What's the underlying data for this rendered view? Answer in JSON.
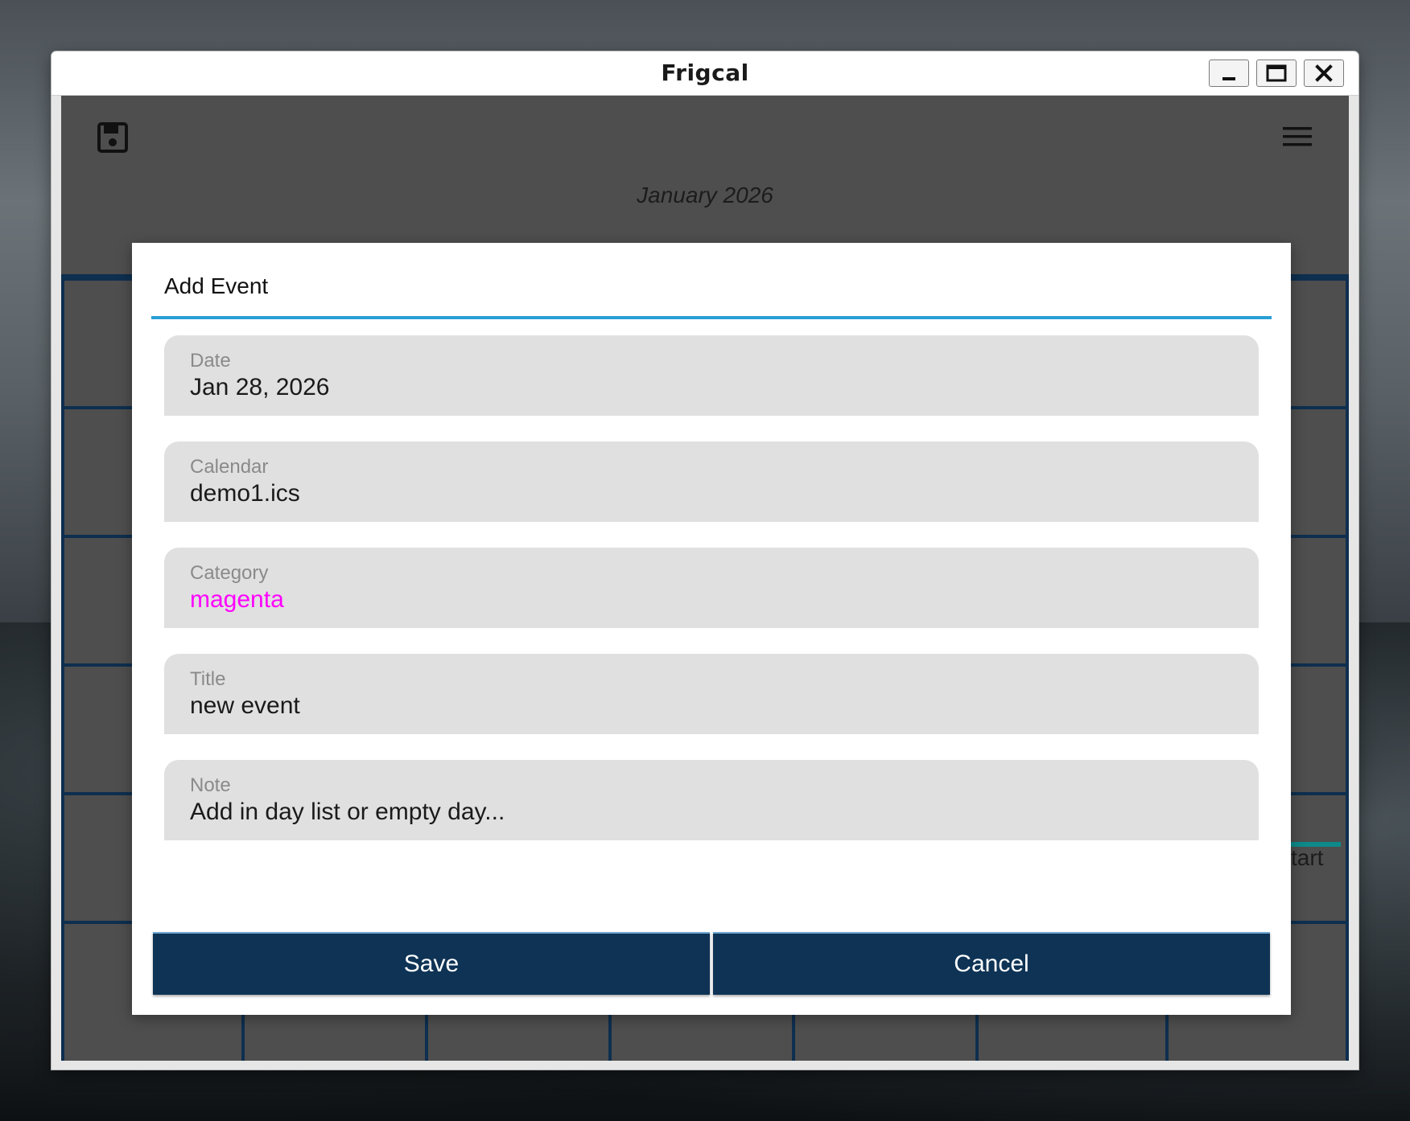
{
  "window": {
    "title": "Frigcal",
    "controls": {
      "minimize_icon": "minimize-icon",
      "maximize_icon": "maximize-icon",
      "close_icon": "close-icon"
    }
  },
  "toolbar": {
    "save_icon": "save-disk-icon",
    "menu_icon": "hamburger-menu-icon"
  },
  "calendar": {
    "month_label": "January 2026",
    "visible_event_text": "start"
  },
  "dialog": {
    "title": "Add Event",
    "fields": [
      {
        "label": "Date",
        "value": "Jan 28, 2026"
      },
      {
        "label": "Calendar",
        "value": "demo1.ics"
      },
      {
        "label": "Category",
        "value": "magenta",
        "value_color": "#ff00ff"
      },
      {
        "label": "Title",
        "value": "new event"
      },
      {
        "label": "Note",
        "value": "Add in day list or empty day..."
      }
    ],
    "save_label": "Save",
    "cancel_label": "Cancel"
  },
  "colors": {
    "accent_rule": "#2a9fd6",
    "button_bg": "#0e3355",
    "grid_line": "#0e2f4f",
    "app_bg": "#4e4e4e"
  }
}
